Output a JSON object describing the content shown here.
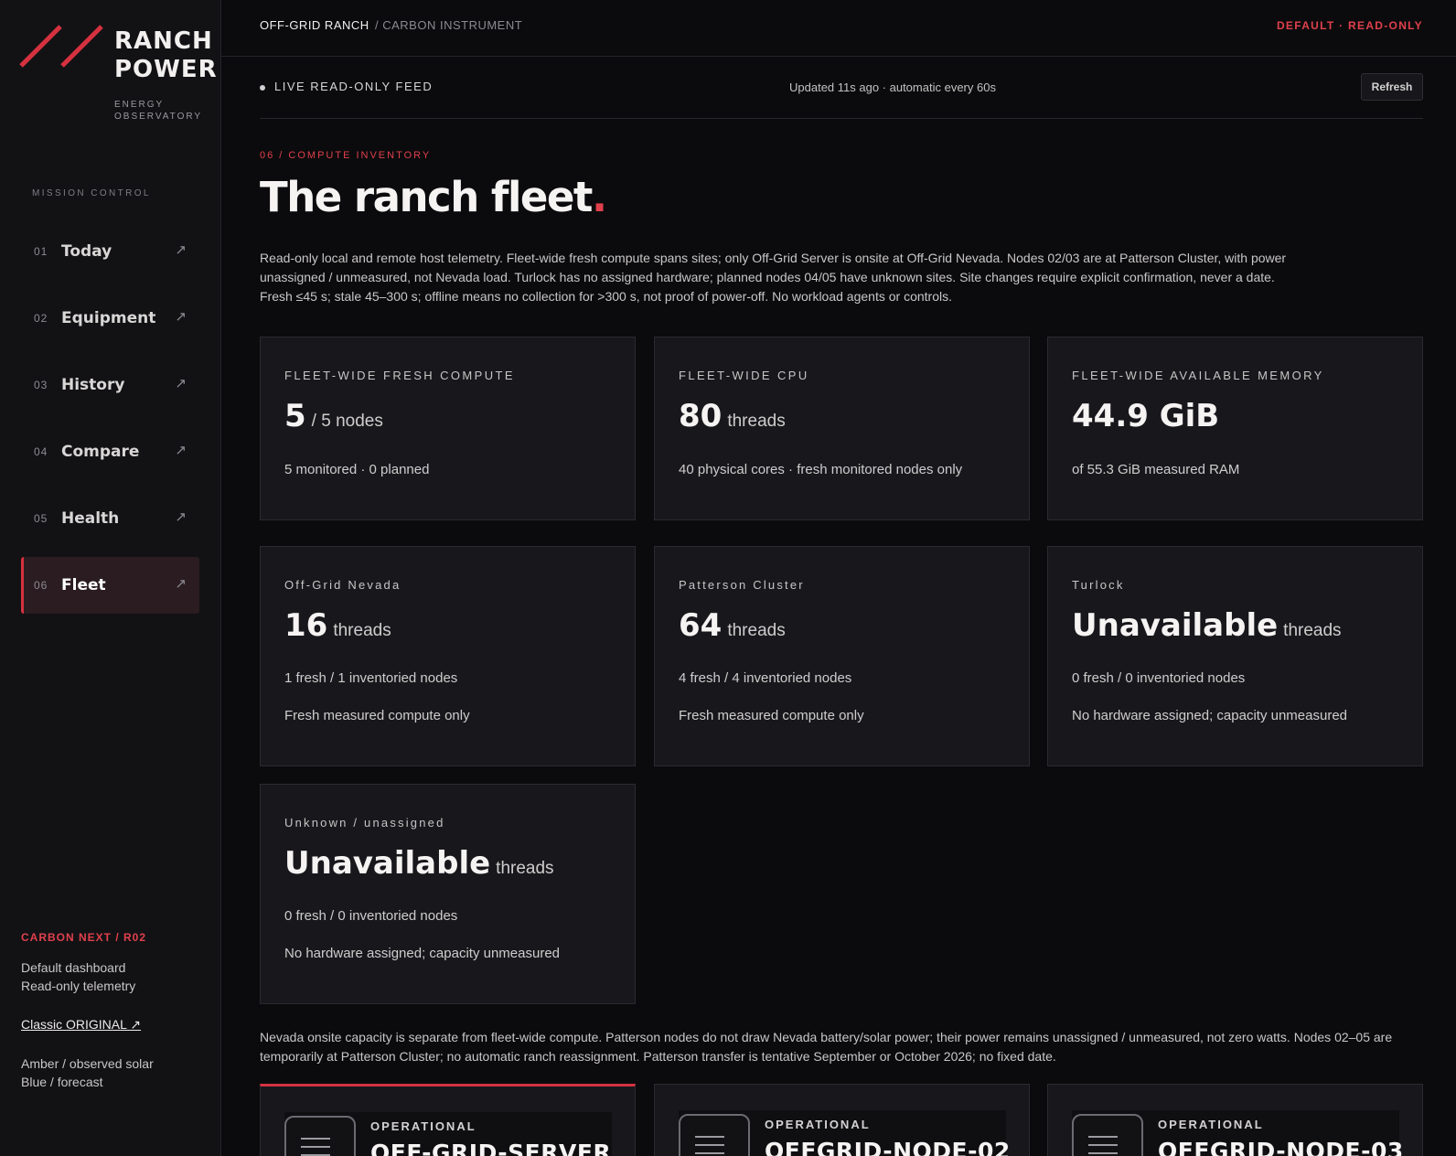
{
  "brand": {
    "title_line1": "RANCH",
    "title_line2": "POWER",
    "subtitle_line1": "ENERGY",
    "subtitle_line2": "OBSERVATORY",
    "accent_color": "#d6313f"
  },
  "sidebar": {
    "section_label": "MISSION CONTROL",
    "items": [
      {
        "num": "01",
        "label": "Today",
        "icon": "arrow-up-right-icon",
        "active": false
      },
      {
        "num": "02",
        "label": "Equipment",
        "icon": "arrow-up-right-icon",
        "active": false
      },
      {
        "num": "03",
        "label": "History",
        "icon": "arrow-up-right-icon",
        "active": false
      },
      {
        "num": "04",
        "label": "Compare",
        "icon": "arrow-up-right-icon",
        "active": false
      },
      {
        "num": "05",
        "label": "Health",
        "icon": "arrow-up-right-icon",
        "active": false
      },
      {
        "num": "06",
        "label": "Fleet",
        "icon": "arrow-up-right-icon",
        "active": true
      }
    ],
    "footer": {
      "version": "CARBON NEXT / R02",
      "line1": "Default dashboard",
      "line2": "Read-only telemetry",
      "classic_link": "Classic ORIGINAL ↗",
      "legend1": "Amber / observed solar",
      "legend2": "Blue / forecast"
    }
  },
  "topbar": {
    "crumb_home": "OFF-GRID RANCH",
    "crumb_current": "/ CARBON INSTRUMENT",
    "mode": "DEFAULT · READ-ONLY"
  },
  "feed": {
    "label": "LIVE READ-ONLY FEED",
    "updated": "Updated 11s ago · automatic every 60s",
    "refresh": "Refresh"
  },
  "page": {
    "eyebrow": "06 / COMPUTE INVENTORY",
    "title": "The ranch fleet",
    "title_dot": ".",
    "intro": "Read-only local and remote host telemetry. Fleet-wide fresh compute spans sites; only Off-Grid Server is onsite at Off-Grid Nevada. Nodes 02/03 are at Patterson Cluster, with power unassigned / unmeasured, not Nevada load. Turlock has no assigned hardware; planned nodes 04/05 have unknown sites. Site changes require explicit confirmation, never a date. Fresh ≤45 s; stale 45–300 s; offline means no collection for >300 s, not proof of power-off. No workload agents or controls."
  },
  "summary_cards": [
    {
      "eyebrow": "FLEET-WIDE FRESH COMPUTE",
      "value": "5",
      "unit": "/ 5 nodes",
      "detail": "5 monitored · 0 planned"
    },
    {
      "eyebrow": "FLEET-WIDE CPU",
      "value": "80",
      "unit": "threads",
      "detail": "40 physical cores · fresh monitored nodes only"
    },
    {
      "eyebrow": "FLEET-WIDE AVAILABLE MEMORY",
      "value": "44.9 GiB",
      "unit": "",
      "detail": "of 55.3 GiB measured RAM"
    }
  ],
  "site_cards": [
    {
      "site": "Off-Grid Nevada",
      "value": "16",
      "unit": "threads",
      "nodes": "1 fresh / 1 inventoried nodes",
      "note": "Fresh measured compute only"
    },
    {
      "site": "Patterson Cluster",
      "value": "64",
      "unit": "threads",
      "nodes": "4 fresh / 4 inventoried nodes",
      "note": "Fresh measured compute only"
    },
    {
      "site": "Turlock",
      "value": "Unavailable",
      "unit": "threads",
      "nodes": "0 fresh / 0 inventoried nodes",
      "note": "No hardware assigned; capacity unmeasured"
    },
    {
      "site": "Unknown / unassigned",
      "value": "Unavailable",
      "unit": "threads",
      "nodes": "0 fresh / 0 inventoried nodes",
      "note": "No hardware assigned; capacity unmeasured"
    }
  ],
  "footnote": "Nevada onsite capacity is separate from fleet-wide compute. Patterson nodes do not draw Nevada battery/solar power; their power remains unassigned / unmeasured, not zero watts. Nodes 02–05 are temporarily at Patterson Cluster; no automatic ranch reassignment. Patterson transfer is tentative September or October 2026; no fixed date.",
  "node_cards": [
    {
      "status": "OPERATIONAL",
      "name": "OFF-GRID-SERVER",
      "icon": "server-icon"
    },
    {
      "status": "OPERATIONAL",
      "name": "OFFGRID-NODE-02",
      "icon": "server-icon"
    },
    {
      "status": "OPERATIONAL",
      "name": "OFFGRID-NODE-03",
      "icon": "server-icon"
    }
  ]
}
